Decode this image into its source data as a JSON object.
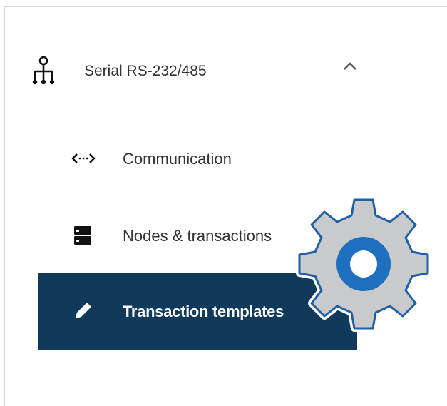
{
  "menu": {
    "section": {
      "label": "Serial RS-232/485",
      "icon": "network-hierarchy-icon",
      "expanded": true,
      "toggle_icon": "chevron-up-icon"
    },
    "items": [
      {
        "label": "Communication",
        "icon": "code-arrows-icon",
        "active": false
      },
      {
        "label": "Nodes & transactions",
        "icon": "server-icon",
        "active": false
      },
      {
        "label": "Transaction templates",
        "icon": "pencil-icon",
        "active": true
      }
    ]
  },
  "overlay": {
    "icon": "gear-icon"
  },
  "colors": {
    "active_background": "#0f3a5c",
    "active_text": "#ffffff",
    "text": "#333333",
    "gear_fill": "#c9cacc",
    "gear_hub": "#1f6fbf"
  }
}
